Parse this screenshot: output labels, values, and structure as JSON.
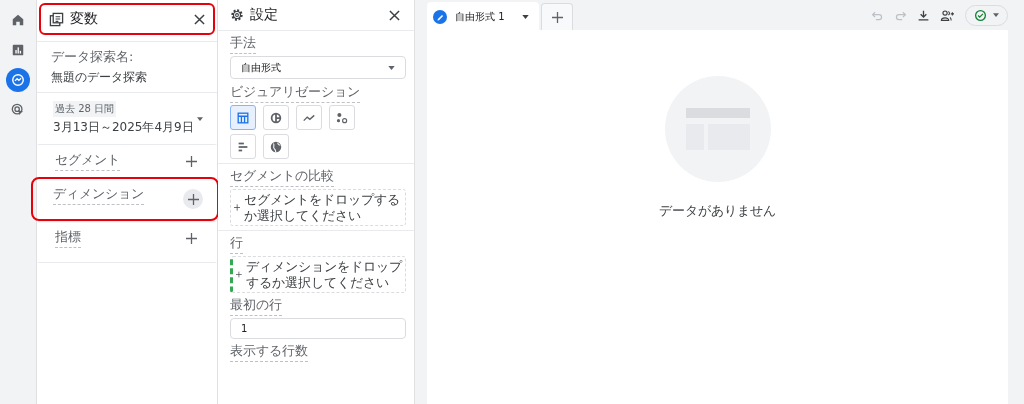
{
  "nav_rail": [
    {
      "kind": "home",
      "selected": false
    },
    {
      "kind": "reports",
      "selected": false
    },
    {
      "kind": "explore",
      "selected": true
    },
    {
      "kind": "advertising",
      "selected": false
    }
  ],
  "variables_panel": {
    "title": "変数",
    "highlighted": true,
    "explore_name": {
      "label": "データ探索名:",
      "value": "無題のデータ探索"
    },
    "date_range": {
      "badge": "過去 28 日間",
      "range": "3月13日～2025年4月9日"
    },
    "sections": [
      {
        "label": "セグメント",
        "highlighted": false
      },
      {
        "label": "ディメンション",
        "highlighted": true
      },
      {
        "label": "指標",
        "highlighted": false
      }
    ]
  },
  "settings_panel": {
    "title": "設定",
    "technique": {
      "label": "手法",
      "value": "自由形式"
    },
    "visualization": {
      "label": "ビジュアリゼーション",
      "options": [
        {
          "kind": "table",
          "selected": true
        },
        {
          "kind": "donut",
          "selected": false
        },
        {
          "kind": "line",
          "selected": false
        },
        {
          "kind": "scatter",
          "selected": false
        },
        {
          "kind": "bar",
          "selected": false
        },
        {
          "kind": "globe",
          "selected": false
        }
      ]
    },
    "segment_comparison": {
      "label": "セグメントの比較",
      "dropzone": "セグメントをドロップするか選択してください"
    },
    "rows": {
      "label": "行",
      "dropzone": "ディメンションをドロップするか選択してください"
    },
    "first_row": {
      "label": "最初の行",
      "value": "1"
    },
    "rows_shown": {
      "label": "表示する行数"
    }
  },
  "canvas": {
    "tabs": [
      {
        "label": "自由形式 1",
        "selected": true
      }
    ],
    "empty_message": "データがありません"
  }
}
